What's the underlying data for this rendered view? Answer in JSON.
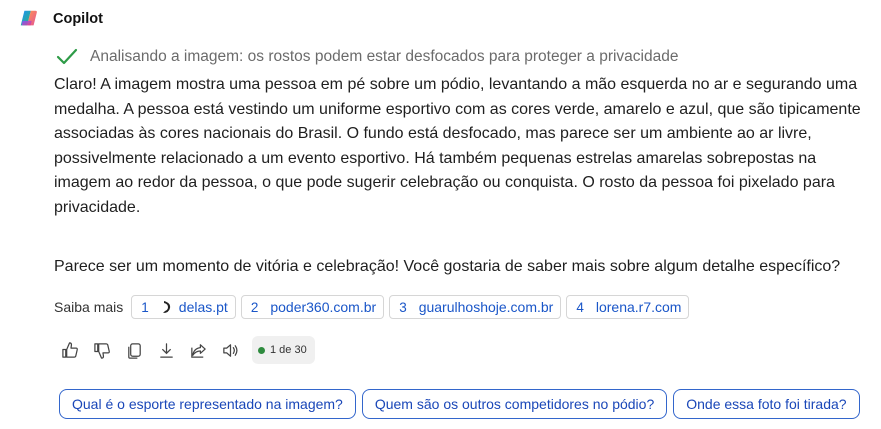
{
  "header": {
    "app_name": "Copilot"
  },
  "status": {
    "text": "Analisando a imagem: os rostos podem estar desfocados para proteger a privacidade"
  },
  "message": {
    "paragraph1": "Claro! A imagem mostra uma pessoa em pé sobre um pódio, levantando a mão esquerda no ar e segurando uma medalha. A pessoa está vestindo um uniforme esportivo com as cores verde, amarelo e azul, que são tipicamente associadas às cores nacionais do Brasil. O fundo está desfocado, mas parece ser um ambiente ao ar livre, possivelmente relacionado a um evento esportivo. Há também pequenas estrelas amarelas sobrepostas na imagem ao redor da pessoa, o que pode sugerir celebração ou conquista. O rosto da pessoa foi pixelado para privacidade.",
    "paragraph2": "Parece ser um momento de vitória e celebração! Você gostaria de saber mais sobre algum detalhe específico?"
  },
  "sources": {
    "label": "Saiba mais",
    "items": [
      {
        "num": "1",
        "domain": "delas.pt"
      },
      {
        "num": "2",
        "domain": "poder360.com.br"
      },
      {
        "num": "3",
        "domain": "guarulhoshoje.com.br"
      },
      {
        "num": "4",
        "domain": "lorena.r7.com"
      }
    ]
  },
  "actions": {
    "icons": [
      "thumbs-up-icon",
      "thumbs-down-icon",
      "copy-icon",
      "download-icon",
      "share-icon",
      "speaker-icon"
    ],
    "pager_text": "1 de 30",
    "pager_dot_color": "#2e8b3e"
  },
  "suggestions": [
    "Qual é o esporte representado na imagem?",
    "Quem são os outros competidores no pódio?",
    "Onde essa foto foi tirada?"
  ],
  "colors": {
    "accent": "#1a56c8",
    "check": "#2e9b47"
  }
}
